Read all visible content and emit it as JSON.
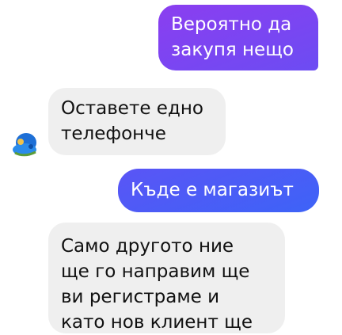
{
  "messages": [
    {
      "sender": "me",
      "text": "Вероятно да\nзакупя нещо"
    },
    {
      "sender": "them",
      "text": "Оставете едно\nтелефонче"
    },
    {
      "sender": "me",
      "text": "Къде е магазиът"
    },
    {
      "sender": "them",
      "text": "Само другото ние\nще го направим ще\nви регистраме и\nкато нов клиент ще"
    }
  ],
  "avatar": {
    "icon": "user-avatar-icon",
    "color": "#1e88e5"
  },
  "colors": {
    "outgoing_gradient_top": "#8b3ef0",
    "outgoing_gradient_bottom": "#3d63f7",
    "incoming_bg": "#efefef",
    "incoming_text": "#111111"
  }
}
